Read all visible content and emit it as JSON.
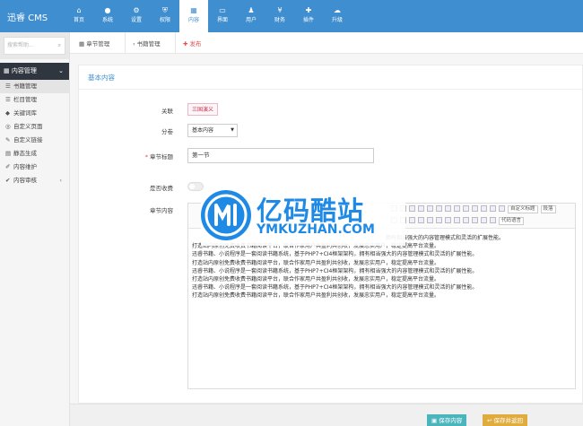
{
  "app": {
    "brand": "迅睿 CMS"
  },
  "topnav": [
    {
      "icon": "⌂",
      "label": "首页"
    },
    {
      "icon": "●",
      "label": "系统"
    },
    {
      "icon": "⚙",
      "label": "设置"
    },
    {
      "icon": "⛨",
      "label": "权限"
    },
    {
      "icon": "▦",
      "label": "内容"
    },
    {
      "icon": "▭",
      "label": "界面"
    },
    {
      "icon": "♟",
      "label": "用户"
    },
    {
      "icon": "¥",
      "label": "财务"
    },
    {
      "icon": "✚",
      "label": "插件"
    },
    {
      "icon": "☁",
      "label": "升级"
    }
  ],
  "sidebar": {
    "search_placeholder": "搜索帮助...",
    "section": "内容管理",
    "items": [
      {
        "icon": "☰",
        "label": "书籍管理"
      },
      {
        "icon": "☰",
        "label": "栏目管理"
      },
      {
        "icon": "◆",
        "label": "关键词库"
      },
      {
        "icon": "◎",
        "label": "自定义页面"
      },
      {
        "icon": "✎",
        "label": "自定义链接"
      },
      {
        "icon": "▤",
        "label": "静态生成"
      },
      {
        "icon": "✐",
        "label": "内容维护"
      },
      {
        "icon": "✔",
        "label": "内容审核"
      }
    ]
  },
  "breadcrumb": [
    "章节管理",
    "书籍管理",
    "发布"
  ],
  "form": {
    "panel_title": "基本内容",
    "labels": {
      "relation": "关联",
      "volume": "分卷",
      "chapter": "章节标题",
      "paid": "是否收费",
      "content": "章节内容"
    },
    "relation_tag": "三国演义",
    "volume_value": "基本内容",
    "chapter_value": "第一节",
    "editor": {
      "font_select": "自定义标题",
      "para_select": "段落",
      "lang_select": "代码语言",
      "paragraphs": [
        "拥有相当强大的内容管理模式和灵活的扩展性能。",
        "打造站内原创免费收费书籍阅读平台，联合作家用户共盈利共创收，发展忠实用户，稳定提高平台流量。",
        "迅睿书籍、小说程序是一套阅读书籍系统，基于PHP7+CI4框架架构，拥有相当强大的内容管理模式和灵活的扩展性能。",
        "打造站内原创免费收费书籍阅读平台，联合作家用户共盈利共创收，发展忠实用户，稳定提高平台流量。",
        "迅睿书籍、小说程序是一套阅读书籍系统，基于PHP7+CI4框架架构，拥有相当强大的内容管理模式和灵活的扩展性能。",
        "打造站内原创免费收费书籍阅读平台，联合作家用户共盈利共创收，发展忠实用户，稳定提高平台流量。",
        "迅睿书籍、小说程序是一套阅读书籍系统，基于PHP7+CI4框架架构，拥有相当强大的内容管理模式和灵活的扩展性能。",
        "打造站内原创免费收费书籍阅读平台，联合作家用户共盈利共创收，发展忠实用户，稳定提高平台流量。"
      ]
    }
  },
  "watermark": {
    "title": "亿码酷站",
    "subtitle": "YMKUZHAN.COM"
  },
  "buttons": {
    "save": "保存内容",
    "save_back": "保存并返回"
  }
}
